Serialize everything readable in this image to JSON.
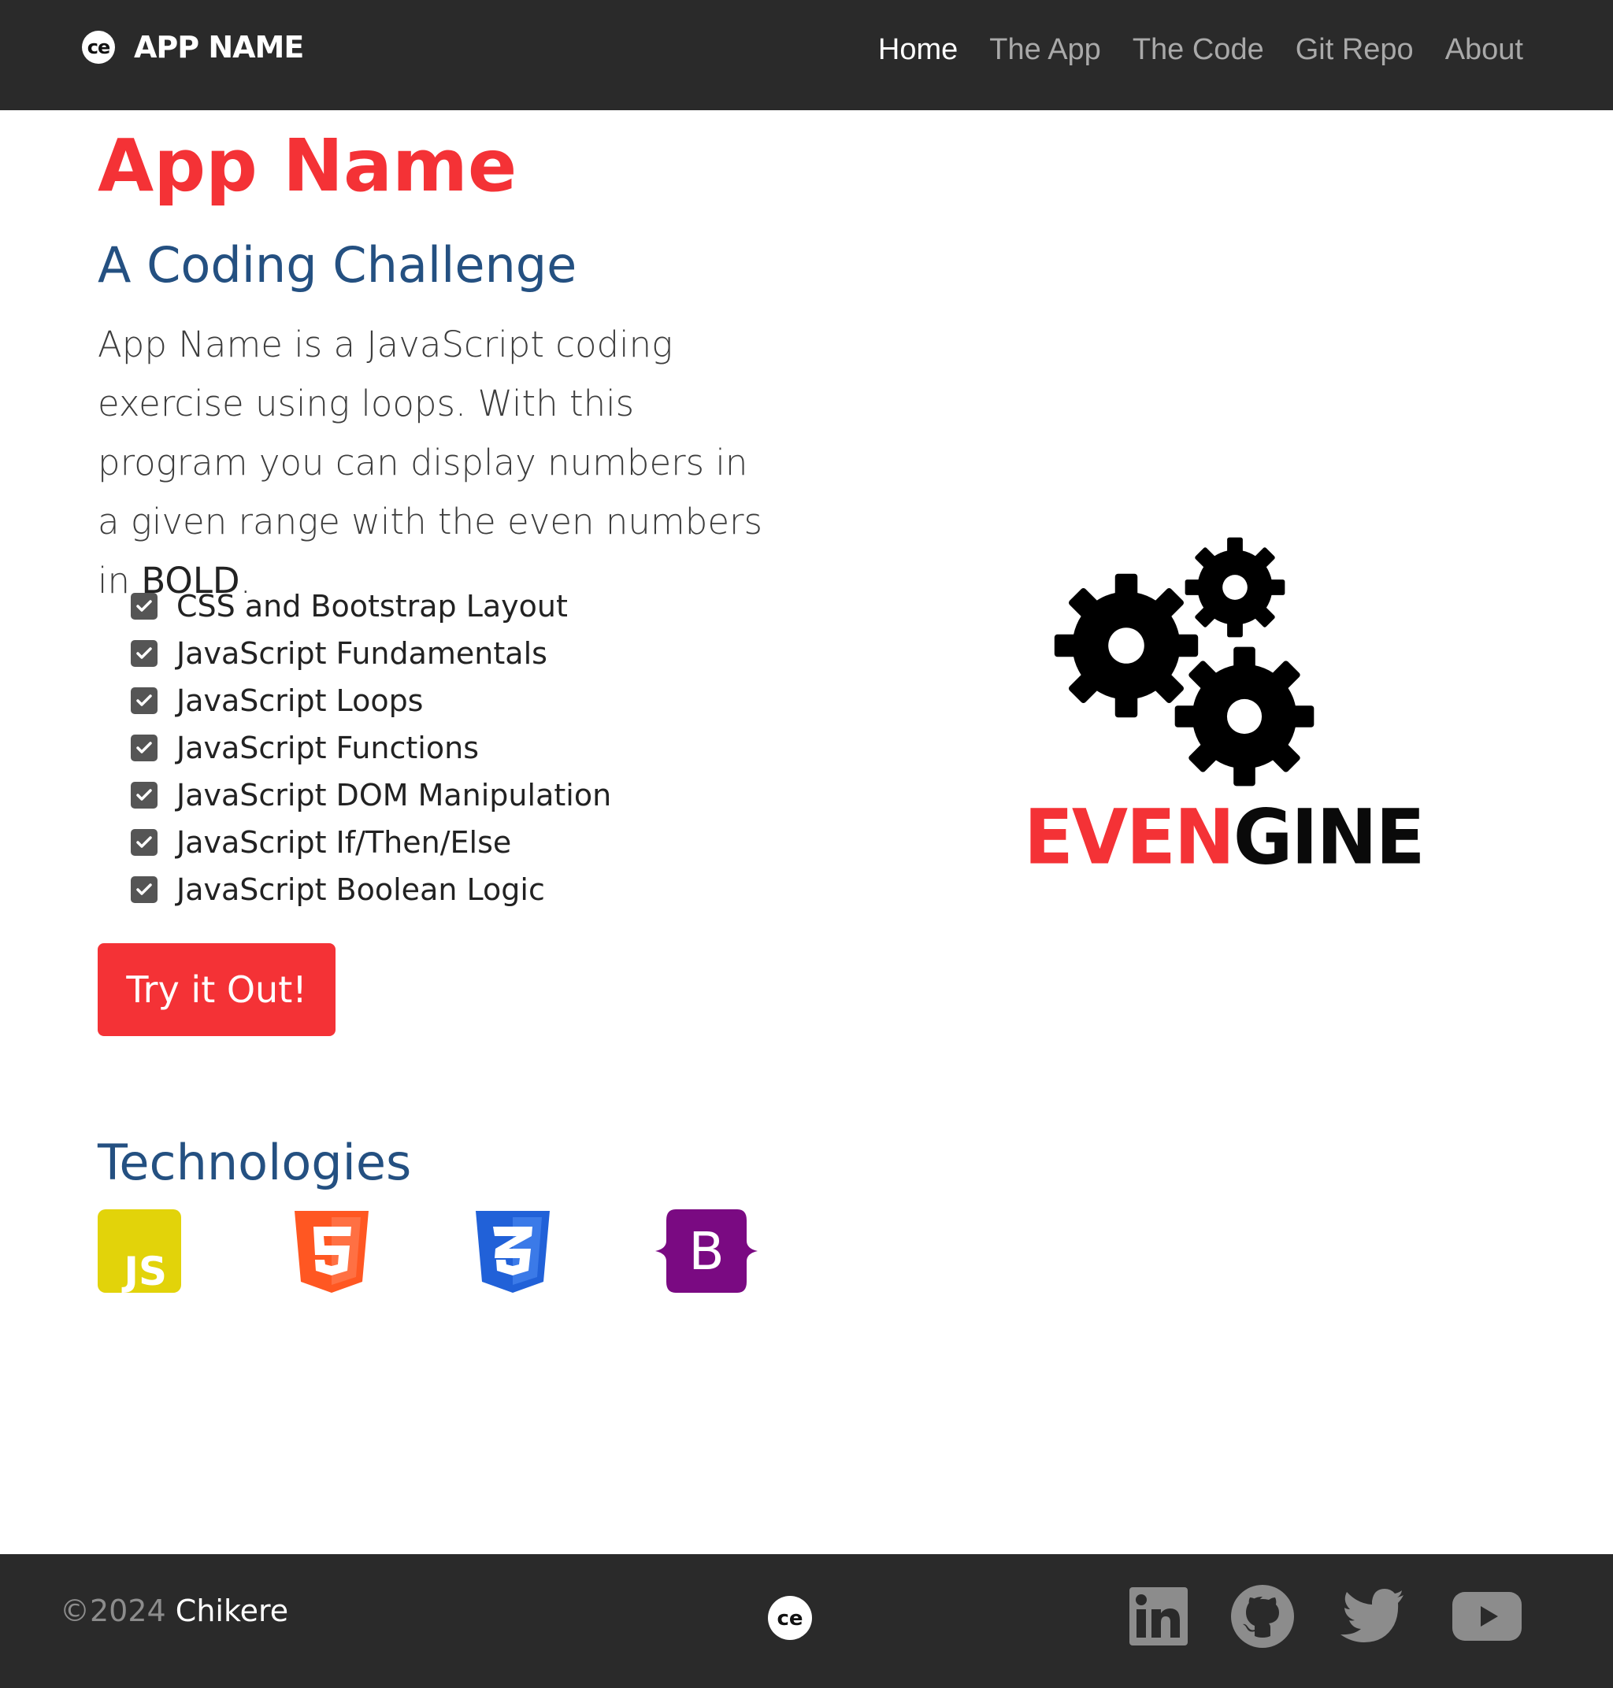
{
  "brand": {
    "logo_text": "ce",
    "name": "APP NAME"
  },
  "nav": {
    "home": "Home",
    "the_app": "The App",
    "the_code": "The Code",
    "git_repo": "Git Repo",
    "about": "About"
  },
  "hero": {
    "title": "App Name",
    "subtitle": "A Coding Challenge",
    "lead_text": "App Name is a JavaScript coding exercise using loops. With this program you can display numbers in a given range with the even numbers in ",
    "lead_emphasis": "BOLD",
    "lead_end": ".",
    "features": [
      "CSS and Bootstrap Layout",
      "JavaScript Fundamentals",
      "JavaScript Loops",
      "JavaScript Functions",
      "JavaScript DOM Manipulation",
      "JavaScript If/Then/Else",
      "JavaScript Boolean Logic"
    ],
    "cta_label": "Try it Out!"
  },
  "logo_image": {
    "text_red": "EVEN",
    "text_black": "GINE"
  },
  "technologies": {
    "title": "Technologies",
    "icons": [
      "javascript-icon",
      "html5-icon",
      "css3-icon",
      "bootstrap-icon"
    ],
    "js_label": "JS",
    "bootstrap_label": "B"
  },
  "footer": {
    "copyright_prefix": "©2024 ",
    "copyright_name": "Chikere",
    "logo_text": "ce",
    "social_icons": [
      "linkedin-icon",
      "github-icon",
      "twitter-icon",
      "youtube-icon"
    ]
  },
  "colors": {
    "accent_red": "#f43236",
    "heading_blue": "#245081",
    "dark_bg": "#2a2a2a",
    "js_yellow": "#e2d30a",
    "html_orange": "#ff5722",
    "css_blue": "#2161d8",
    "bootstrap_purple": "#7a0a82"
  }
}
